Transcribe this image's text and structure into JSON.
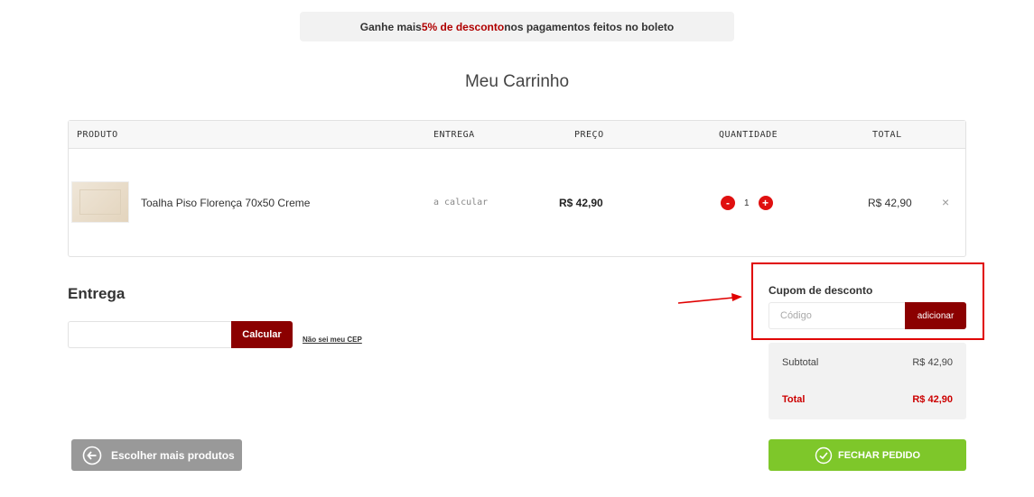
{
  "promo": {
    "prefix": "Ganhe mais ",
    "highlight": "5% de desconto",
    "suffix": " nos pagamentos feitos no boleto"
  },
  "page_title": "Meu Carrinho",
  "cart": {
    "columns": {
      "produto": "PRODUTO",
      "entrega": "ENTREGA",
      "preco": "PREÇO",
      "quantidade": "QUANTIDADE",
      "total": "TOTAL"
    },
    "items": [
      {
        "name": "Toalha Piso Florença 70x50 Creme",
        "delivery": "a calcular",
        "price": "R$ 42,90",
        "quantity": "1",
        "total": "R$ 42,90",
        "minus": "-",
        "plus": "+",
        "remove": "×"
      }
    ]
  },
  "entrega": {
    "title": "Entrega",
    "cep_value": "",
    "calc_label": "Calcular",
    "nao_sei_label": "Não sei meu CEP"
  },
  "coupon": {
    "title": "Cupom de desconto",
    "placeholder": "Código",
    "add_label": "adicionar"
  },
  "summary": {
    "subtotal_label": "Subtotal",
    "subtotal_value": "R$ 42,90",
    "total_label": "Total",
    "total_value": "R$ 42,90"
  },
  "actions": {
    "back_label": "Escolher mais produtos",
    "close_label": "FECHAR PEDIDO"
  },
  "colors": {
    "brand": "#8b0000",
    "accent_red": "#e01010",
    "success": "#7ec72a",
    "annotation": "#e00000"
  }
}
